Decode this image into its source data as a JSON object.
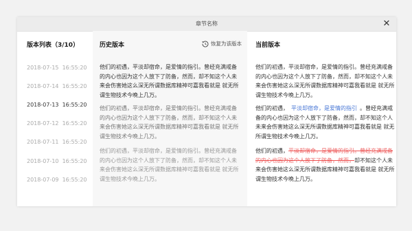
{
  "dialog": {
    "title": "章节名称",
    "close_label": "✕"
  },
  "version_list": {
    "header": "版本列表（3/10）",
    "items": [
      {
        "label": "2018-07-15  16:55:20",
        "active": false
      },
      {
        "label": "2018-07-14  16:55:20",
        "active": false
      },
      {
        "label": "2018-07-13  16:55:20",
        "active": true
      },
      {
        "label": "2018-07-12  16:55:20",
        "active": false
      },
      {
        "label": "2018-07-11  16:55:20",
        "active": false
      },
      {
        "label": "2018-07-10  16:55:20",
        "active": false
      },
      {
        "label": "2018-07-09  16:55:20",
        "active": false
      }
    ]
  },
  "history": {
    "header": "历史版本",
    "restore_label": "恢复为该版本",
    "paragraphs": [
      "他们的初遇，平淡却宿命，是爱情的指引。曾经充满戒备的内心也因为这个人放下了防备，然而，却不知这个人未来会伤害她这么深无所谓数据库精神可嘉我看就是 就无所谓生物技术今晚上几万。",
      "他们的初遇，平淡却宿命，是爱情的指引。曾经充满戒备的内心也因为这个人放下了防备，然而，却不知这个人未来会伤害她这么深无所谓数据库精神可嘉我看就是 就无所谓生物技术今晚上几万。",
      "他们的初遇，平淡却宿命，是爱情的指引。曾经充满戒备的内心也因为这个人放下了防备，然而，却不知这个人未来会伤害她这么深无所谓数据库精神可嘉我看就是 就无所谓生物技术今晚上几万。"
    ]
  },
  "current": {
    "header": "当前版本",
    "p1": "他们的初遇，平淡却宿命，是爱情的指引。曾经充满戒备的内心也因为这个人放下了防备，然而，却不知这个人未来会伤害她这么深无所谓数据库精神可嘉我看就是 就无所谓生物技术今晚上几万。",
    "p2_a": "他们的初遇，",
    "p2_ins": "平淡却宿命，是爱情的指引",
    "p2_b": "。曾经充满戒备的内心也因为这个人放下了防备，然而，却不知这个人未来会伤害她这么深无所谓数据库精神可嘉我看就是 就无所谓生物技术今晚上几万。",
    "p3_a": "他们的初遇，",
    "p3_del": "平淡却宿命，是爱情的指引。曾经充满戒备的内心也因为这个人放下了防备，然而，",
    "p3_b": "却不知这个人未来会伤害她这么深无所谓数据库精神可嘉我看就是 就无所谓生物技术今晚上几万。"
  },
  "colors": {
    "insert": "#4a78d6",
    "delete": "#e66666",
    "history_bg": "#f7f7f7"
  },
  "icons": {
    "restore": "history-icon",
    "close": "close-icon"
  }
}
